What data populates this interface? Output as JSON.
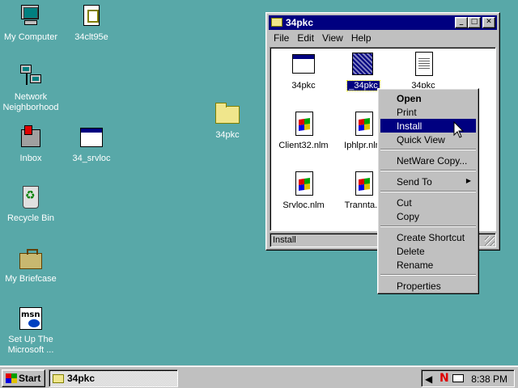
{
  "desktop": {
    "icons": [
      {
        "label": "My Computer"
      },
      {
        "label": "34clt95e"
      },
      {
        "label_line1": "Network",
        "label_line2": "Neighborhood"
      },
      {
        "label": "Inbox"
      },
      {
        "label": "34_srvloc"
      },
      {
        "label": "Recycle Bin"
      },
      {
        "label": "My Briefcase"
      },
      {
        "label_line1": "Set Up The",
        "label_line2": "Microsoft ..."
      },
      {
        "label": "34pkc"
      }
    ]
  },
  "window": {
    "title": "34pkc",
    "menu": [
      "File",
      "Edit",
      "View",
      "Help"
    ],
    "files": [
      {
        "label": "34pkc"
      },
      {
        "label": "_34pkc"
      },
      {
        "label": "34pkc"
      },
      {
        "label": "Client32.nlm"
      },
      {
        "label": "Iphlpr.nlm"
      },
      {
        "label": "Srvloc.nlm"
      },
      {
        "label": "Trannta.n"
      }
    ],
    "status": "Install",
    "buttons": {
      "minimize": "_",
      "maximize": "□",
      "close": "✕"
    }
  },
  "context_menu": {
    "items": [
      "Open",
      "Print",
      "Install",
      "Quick View",
      "NetWare Copy...",
      "Send To",
      "Cut",
      "Copy",
      "Create Shortcut",
      "Delete",
      "Rename",
      "Properties"
    ],
    "highlighted": "Install",
    "submenu_arrow": "▶"
  },
  "taskbar": {
    "start_label": "Start",
    "task_label": "34pkc",
    "clock": "8:38 PM",
    "tray_n": "N",
    "speaker": "◀"
  },
  "colors": {
    "desktop": "#58A8A8",
    "titlebar": "#000080",
    "face": "#C0C0C0",
    "highlight": "#000080"
  }
}
